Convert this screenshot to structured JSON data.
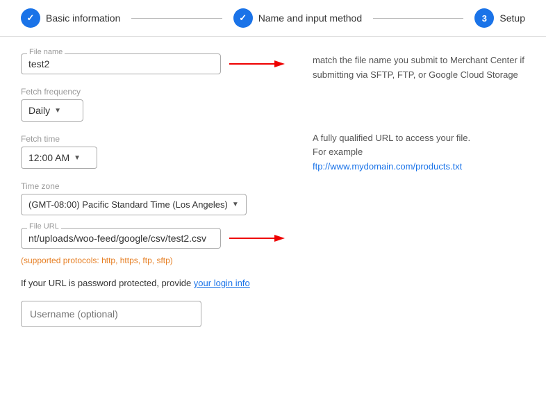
{
  "stepper": {
    "steps": [
      {
        "id": "basic-info",
        "label": "Basic information",
        "state": "completed",
        "icon": "✓",
        "number": null
      },
      {
        "id": "name-input",
        "label": "Name and input method",
        "state": "completed",
        "icon": "✓",
        "number": null
      },
      {
        "id": "setup",
        "label": "Setup",
        "state": "active",
        "icon": null,
        "number": "3"
      }
    ]
  },
  "form": {
    "file_name_label": "File name",
    "file_name_value": "test2",
    "file_name_hint": "match the file name you submit to Merchant Center if submitting via SFTP, FTP, or Google Cloud Storage",
    "fetch_frequency_label": "Fetch frequency",
    "fetch_frequency_value": "Daily",
    "fetch_time_label": "Fetch time",
    "fetch_time_value": "12:00 AM",
    "time_zone_label": "Time zone",
    "time_zone_value": "(GMT-08:00) Pacific Standard Time (Los Angeles)",
    "file_url_label": "File URL",
    "file_url_value": "nt/uploads/woo-feed/google/csv/test2.csv",
    "file_url_hint_1": "A fully qualified URL to access your file.",
    "file_url_hint_2": "For example",
    "file_url_hint_link": "ftp://www.mydomain.com/products.txt",
    "protocols_text": "(supported protocols: http, https, ftp, sftp)",
    "password_protected_text": "If your URL is password protected, provide your login info",
    "username_placeholder": "Username (optional)"
  }
}
